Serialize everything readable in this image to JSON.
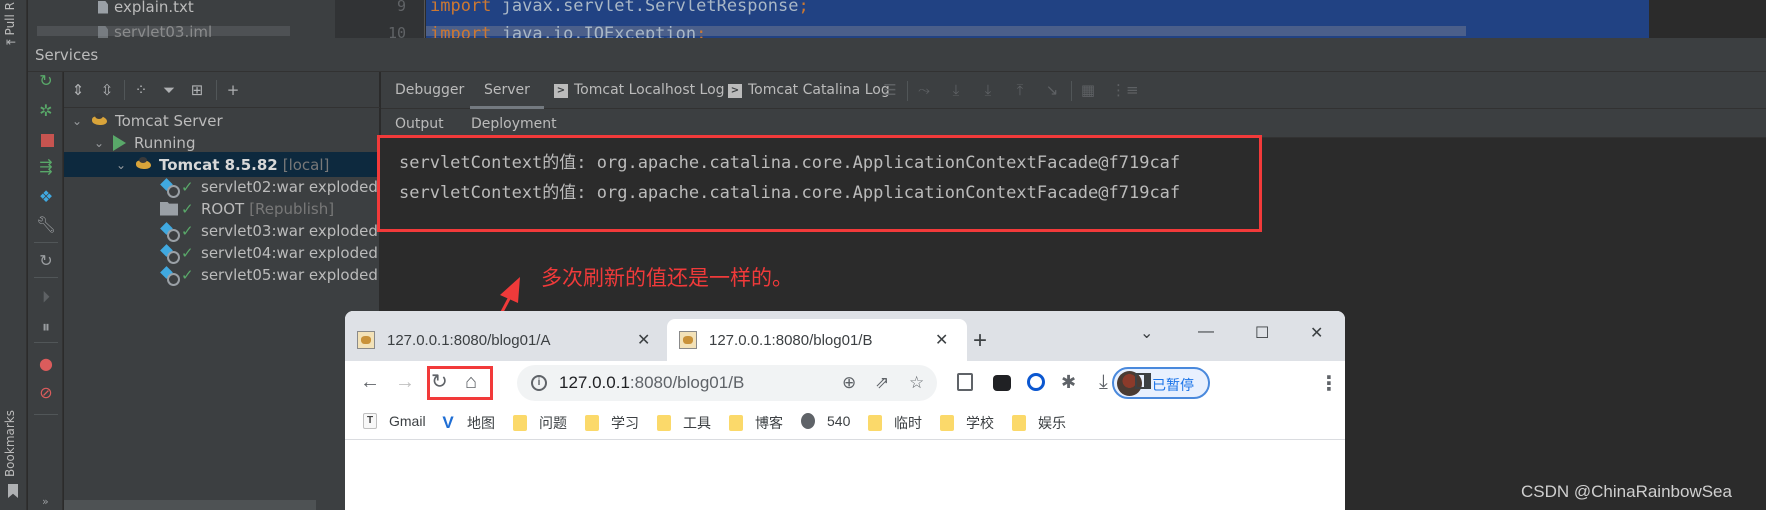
{
  "side_stripe": {
    "top_label": "Pull R",
    "bottom_label": "Bookmarks"
  },
  "project_tree": {
    "files": [
      "explain.txt",
      "servlet03.iml"
    ]
  },
  "editor": {
    "line_numbers": [
      "9",
      "10"
    ],
    "lines": [
      {
        "keyword": "import",
        "text": " javax.servlet.ServletResponse",
        "semicolon": ";"
      },
      {
        "keyword": "import",
        "text": " java.io.IOException",
        "semicolon": ";"
      }
    ],
    "selection_color": "#214283"
  },
  "services": {
    "title": "Services",
    "left_toolbar": [
      "rerun-icon",
      "debug-icon",
      "stop-icon",
      "deploy-icon",
      "artifact-icon",
      "settings-wrench-icon",
      "refresh-icon",
      "resume-icon",
      "pause-icon",
      "view-breakpoints-icon",
      "mute-breakpoints-icon"
    ],
    "more_label": "»",
    "tree_toolbar": [
      "expand-all-icon",
      "collapse-all-icon",
      "group-by-icon",
      "filter-icon",
      "new-tab-icon",
      "add-service-icon"
    ],
    "tree": {
      "server": "Tomcat Server",
      "state": "Running",
      "instance": {
        "name": "Tomcat 8.5.82",
        "tag": "[local]"
      },
      "artifacts": [
        {
          "name": "servlet02:war exploded",
          "tag": "",
          "type": "artifact"
        },
        {
          "name": "ROOT",
          "tag": "[Republish]",
          "type": "folder"
        },
        {
          "name": "servlet03:war exploded",
          "tag": "",
          "type": "artifact"
        },
        {
          "name": "servlet04:war exploded",
          "tag": "",
          "type": "artifact"
        },
        {
          "name": "servlet05:war exploded",
          "tag": "",
          "type": "artifact"
        }
      ]
    },
    "tabs": [
      {
        "label": "Debugger",
        "active": false
      },
      {
        "label": "Server",
        "active": true
      },
      {
        "label": "Tomcat Localhost Log",
        "active": false
      },
      {
        "label": "Tomcat Catalina Log",
        "active": false
      }
    ],
    "subtabs": [
      {
        "label": "Output",
        "active": true
      },
      {
        "label": "Deployment",
        "active": false
      }
    ],
    "output_lines": [
      "servletContext的值: org.apache.catalina.core.ApplicationContextFacade@f719caf",
      "servletContext的值: org.apache.catalina.core.ApplicationContextFacade@f719caf"
    ]
  },
  "annotation": {
    "text": "多次刷新的值还是一样的。",
    "color": "#f03a3a"
  },
  "browser": {
    "tabs": [
      {
        "title": "127.0.0.1:8080/blog01/A",
        "active": false
      },
      {
        "title": "127.0.0.1:8080/blog01/B",
        "active": true
      }
    ],
    "new_tab": "+",
    "window_controls": {
      "dropdown": "⌄",
      "minimize": "—",
      "maximize": "☐",
      "close": "✕"
    },
    "address": {
      "host": "127.0.0.1",
      "rest": ":8080/blog01/B"
    },
    "profile_label": "已暂停",
    "bookmarks": [
      {
        "label": "Gmail",
        "icon": "gmail"
      },
      {
        "label": "地图",
        "icon": "v-logo"
      },
      {
        "label": "问题",
        "icon": "folder"
      },
      {
        "label": "学习",
        "icon": "folder"
      },
      {
        "label": "工具",
        "icon": "folder"
      },
      {
        "label": "博客",
        "icon": "folder"
      },
      {
        "label": "540",
        "icon": "globe"
      },
      {
        "label": "临时",
        "icon": "folder"
      },
      {
        "label": "学校",
        "icon": "folder"
      },
      {
        "label": "娱乐",
        "icon": "folder"
      }
    ]
  },
  "watermark": "CSDN @ChinaRainbowSea",
  "colors": {
    "highlight_box": "#f23a3a",
    "ide_panel": "#3c3f41",
    "console_bg": "#2b2b2b",
    "selected_row": "#0d293e"
  }
}
